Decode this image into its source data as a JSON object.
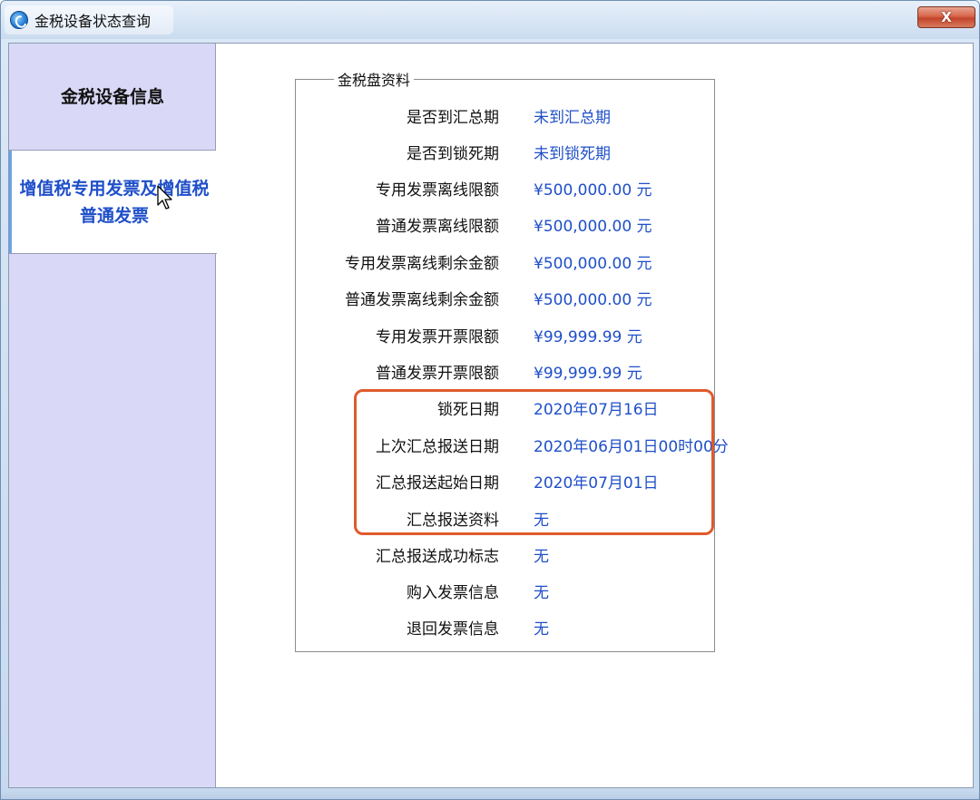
{
  "window": {
    "title": "金税设备状态查询",
    "close_label": "X"
  },
  "sidebar": {
    "items": [
      {
        "label": "金税设备信息"
      },
      {
        "label": "增值税专用发票及增值税普通发票"
      }
    ]
  },
  "group": {
    "legend": "金税盘资料",
    "rows": [
      {
        "label": "是否到汇总期",
        "value": "未到汇总期"
      },
      {
        "label": "是否到锁死期",
        "value": "未到锁死期"
      },
      {
        "label": "专用发票离线限额",
        "value": "¥500,000.00 元"
      },
      {
        "label": "普通发票离线限额",
        "value": "¥500,000.00 元"
      },
      {
        "label": "专用发票离线剩余金额",
        "value": "¥500,000.00 元"
      },
      {
        "label": "普通发票离线剩余金额",
        "value": "¥500,000.00 元"
      },
      {
        "label": "专用发票开票限额",
        "value": "¥99,999.99 元"
      },
      {
        "label": "普通发票开票限额",
        "value": "¥99,999.99 元"
      },
      {
        "label": "锁死日期",
        "value": "2020年07月16日"
      },
      {
        "label": "上次汇总报送日期",
        "value": "2020年06月01日00时00分"
      },
      {
        "label": "汇总报送起始日期",
        "value": "2020年07月01日"
      },
      {
        "label": "汇总报送资料",
        "value": "无"
      },
      {
        "label": "汇总报送成功标志",
        "value": "无"
      },
      {
        "label": "购入发票信息",
        "value": "无"
      },
      {
        "label": "退回发票信息",
        "value": "无"
      }
    ]
  },
  "colors": {
    "highlight": "#e05a2b",
    "value_text": "#1f4fc9",
    "sidebar_bg": "#d9d9f7"
  }
}
